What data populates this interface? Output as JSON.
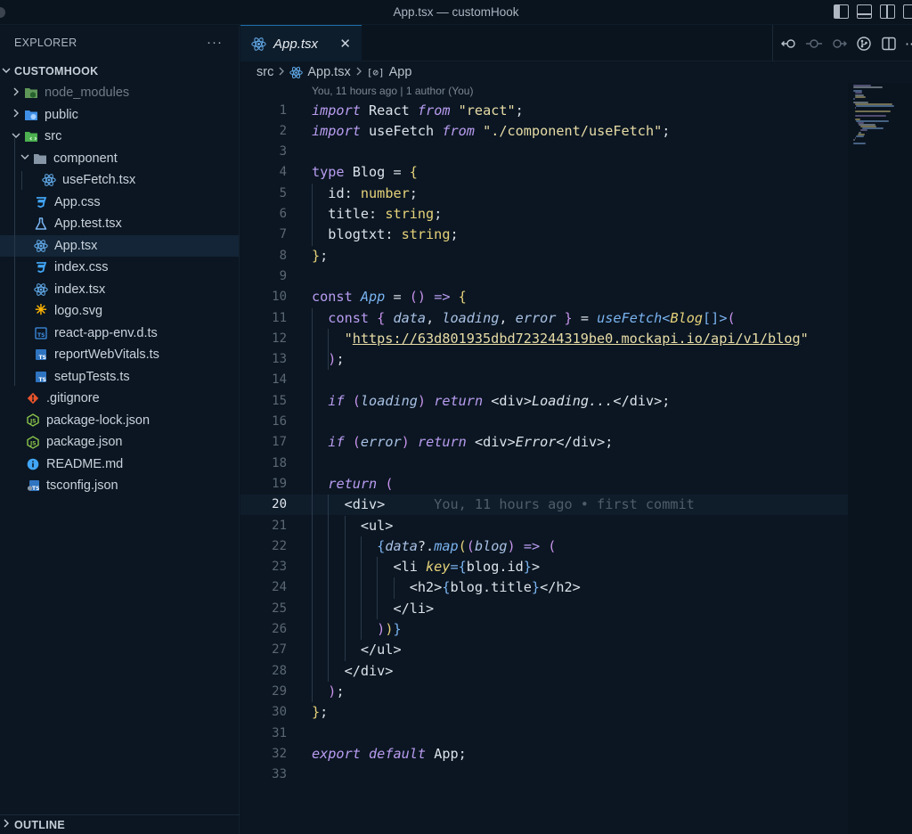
{
  "window": {
    "title": "App.tsx — customHook"
  },
  "sidebar": {
    "header": "EXPLORER",
    "more_icon": "ellipsis-icon",
    "project": "CUSTOMHOOK",
    "items": [
      {
        "label": "node_modules",
        "icon": "folder-node-icon",
        "depth": 0,
        "kind": "folder",
        "open": false,
        "dim": true
      },
      {
        "label": "public",
        "icon": "folder-public-icon",
        "depth": 0,
        "kind": "folder",
        "open": false
      },
      {
        "label": "src",
        "icon": "folder-src-icon",
        "depth": 0,
        "kind": "folder",
        "open": true
      },
      {
        "label": "component",
        "icon": "folder-icon",
        "depth": 1,
        "kind": "folder",
        "open": true
      },
      {
        "label": "useFetch.tsx",
        "icon": "react-icon",
        "depth": 2,
        "kind": "file"
      },
      {
        "label": "App.css",
        "icon": "css-icon",
        "depth": 1,
        "kind": "file"
      },
      {
        "label": "App.test.tsx",
        "icon": "test-flask-icon",
        "depth": 1,
        "kind": "file"
      },
      {
        "label": "App.tsx",
        "icon": "react-icon",
        "depth": 1,
        "kind": "file",
        "selected": true
      },
      {
        "label": "index.css",
        "icon": "css-icon",
        "depth": 1,
        "kind": "file"
      },
      {
        "label": "index.tsx",
        "icon": "react-icon",
        "depth": 1,
        "kind": "file"
      },
      {
        "label": "logo.svg",
        "icon": "svg-icon",
        "depth": 1,
        "kind": "file"
      },
      {
        "label": "react-app-env.d.ts",
        "icon": "ts-def-icon",
        "depth": 1,
        "kind": "file"
      },
      {
        "label": "reportWebVitals.ts",
        "icon": "ts-icon",
        "depth": 1,
        "kind": "file"
      },
      {
        "label": "setupTests.ts",
        "icon": "ts-icon",
        "depth": 1,
        "kind": "file"
      },
      {
        "label": ".gitignore",
        "icon": "git-icon",
        "depth": 0,
        "kind": "file"
      },
      {
        "label": "package-lock.json",
        "icon": "node-json-icon",
        "depth": 0,
        "kind": "file"
      },
      {
        "label": "package.json",
        "icon": "node-json-icon",
        "depth": 0,
        "kind": "file"
      },
      {
        "label": "README.md",
        "icon": "info-icon",
        "depth": 0,
        "kind": "file"
      },
      {
        "label": "tsconfig.json",
        "icon": "tsconfig-icon",
        "depth": 0,
        "kind": "file"
      }
    ],
    "outline": "OUTLINE"
  },
  "tab": {
    "label": "App.tsx",
    "close": "✕"
  },
  "breadcrumb": {
    "folder": "src",
    "file": "App.tsx",
    "symbol": "App",
    "symbol_icon": "[⊘]"
  },
  "codelens": "You, 11 hours ago | 1 author (You)",
  "current_line": 20,
  "inline_blame": "You, 11 hours ago • first commit",
  "code": [
    "1",
    "2",
    "3",
    "4",
    "5",
    "6",
    "7",
    "8",
    "9",
    "10",
    "11",
    "12",
    "13",
    "14",
    "15",
    "16",
    "17",
    "18",
    "19",
    "20",
    "21",
    "22",
    "23",
    "24",
    "25",
    "26",
    "27",
    "28",
    "29",
    "30",
    "31",
    "32",
    "33"
  ],
  "colors": {
    "accent": "#1e6ea8",
    "background": "#0b1622",
    "selection": "#132536"
  }
}
